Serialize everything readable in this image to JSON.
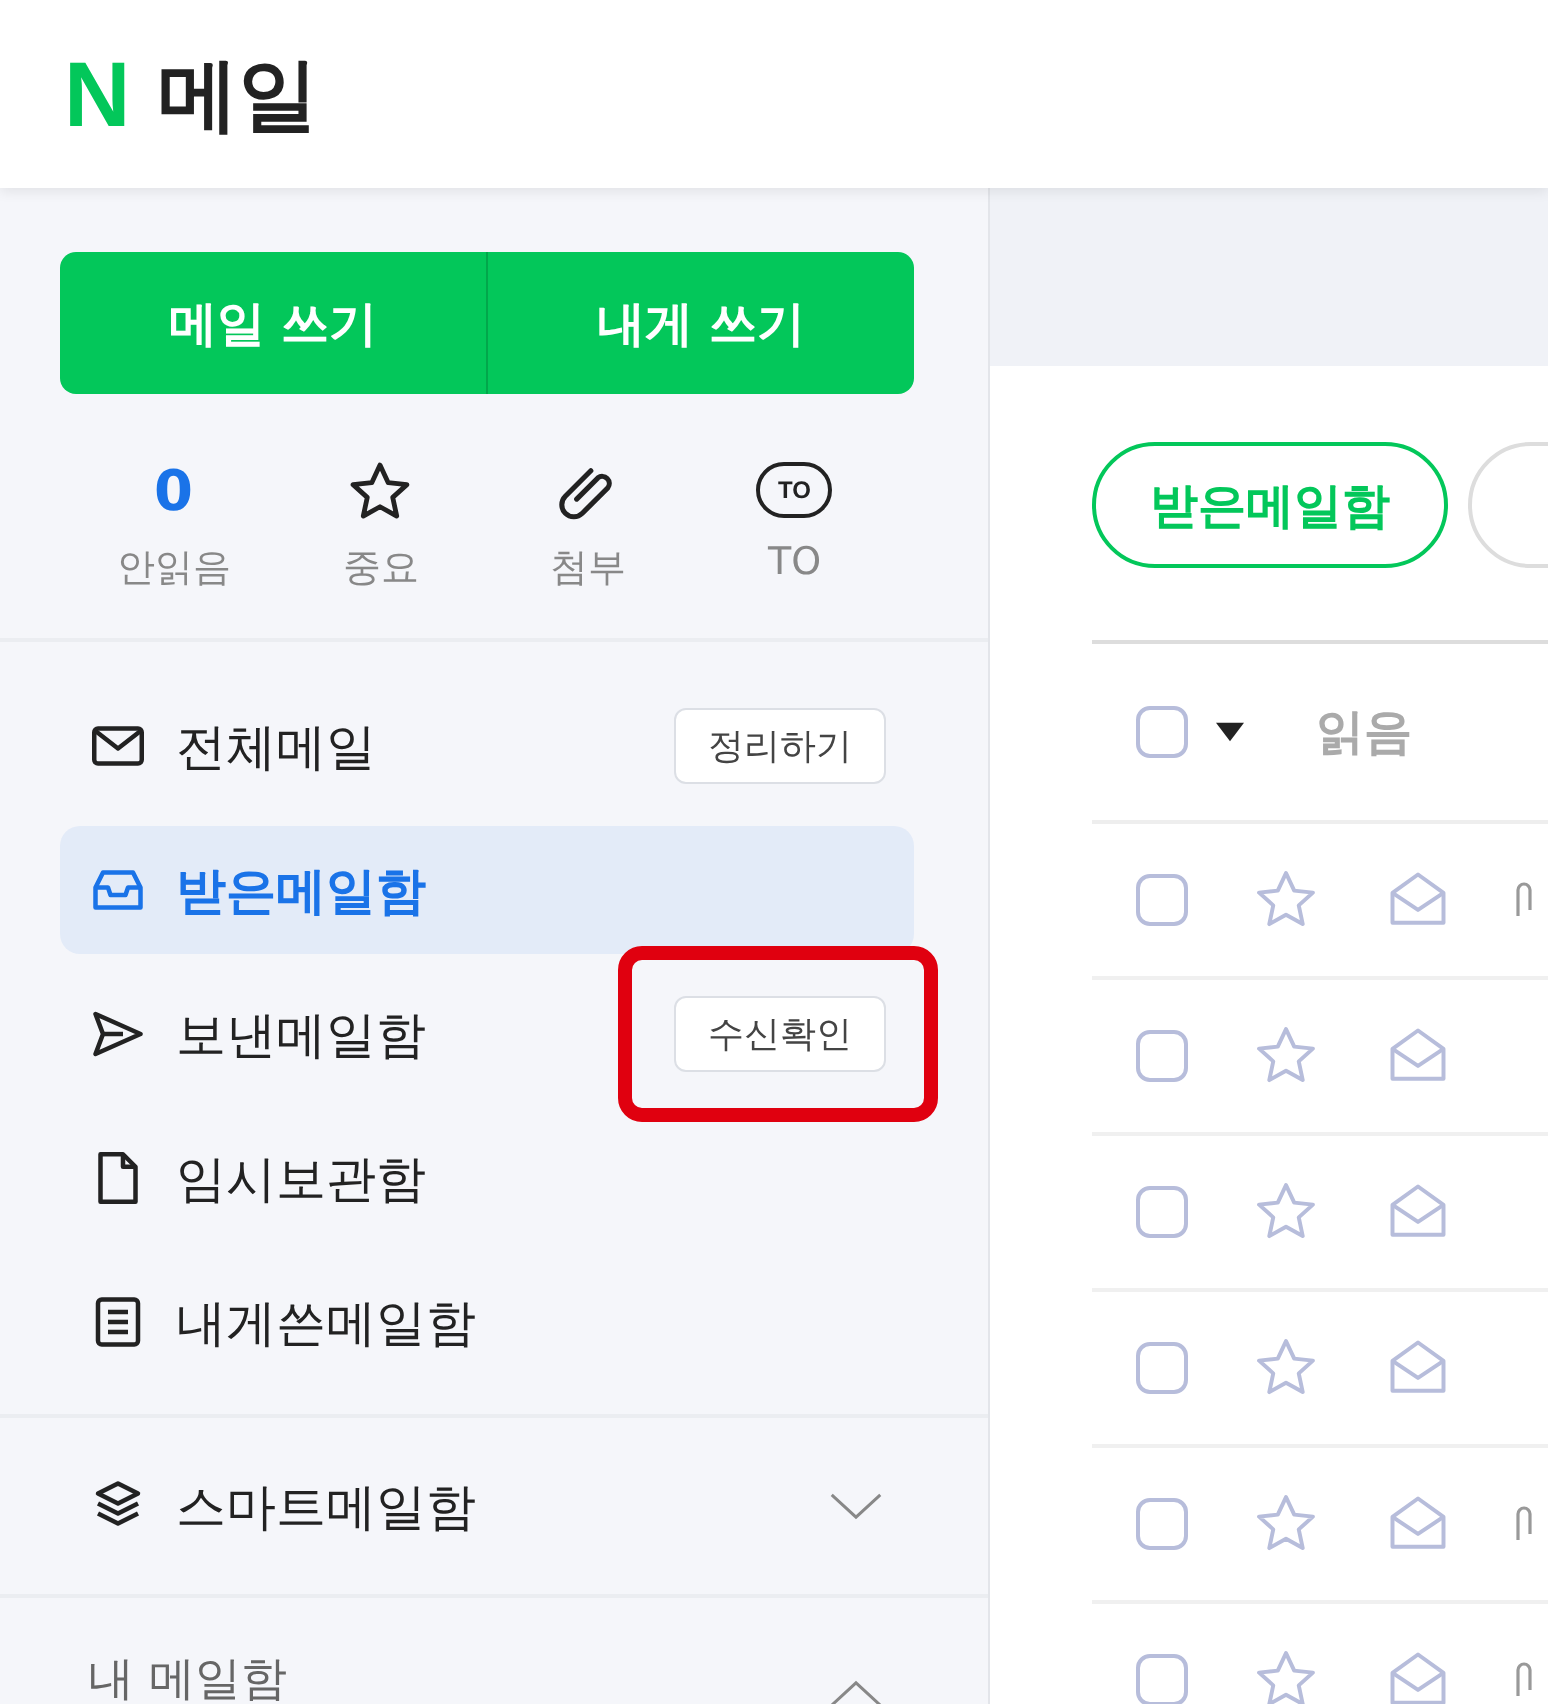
{
  "header": {
    "logo": "N",
    "title": "메일"
  },
  "compose_buttons": [
    "메일 쓰기",
    "내게 쓰기"
  ],
  "quick_filters": [
    {
      "kind": "count",
      "value": "0",
      "label": "안읽음"
    },
    {
      "kind": "star",
      "label": "중요"
    },
    {
      "kind": "clip",
      "label": "첨부"
    },
    {
      "kind": "to",
      "icon_text": "TO",
      "label": "TO"
    }
  ],
  "folders": [
    {
      "kind": "all",
      "label": "전체메일",
      "selected": false,
      "action": "정리하기",
      "highlighted": false
    },
    {
      "kind": "inbox",
      "label": "받은메일함",
      "selected": true
    },
    {
      "kind": "sent",
      "label": "보낸메일함",
      "selected": false,
      "action": "수신확인",
      "highlighted": true
    },
    {
      "kind": "draft",
      "label": "임시보관함",
      "selected": false
    },
    {
      "kind": "self",
      "label": "내게쓴메일함",
      "selected": false
    }
  ],
  "smart_mailbox": {
    "label": "스마트메일함",
    "expanded": false
  },
  "my_mailbox": {
    "label": "내 메일함",
    "expanded": true
  },
  "filter_tabs": [
    {
      "label": "받은메일함",
      "selected": true
    },
    {
      "selected": false
    }
  ],
  "list_header": {
    "checked": false,
    "column": "읽음"
  },
  "rows": [
    {
      "checked": false,
      "starred": false,
      "attachment": true
    },
    {
      "checked": false,
      "starred": false,
      "attachment": false
    },
    {
      "checked": false,
      "starred": false,
      "attachment": false
    },
    {
      "checked": false,
      "starred": false,
      "attachment": false
    },
    {
      "checked": false,
      "starred": false,
      "attachment": true
    },
    {
      "checked": false,
      "starred": false,
      "attachment": true
    }
  ]
}
